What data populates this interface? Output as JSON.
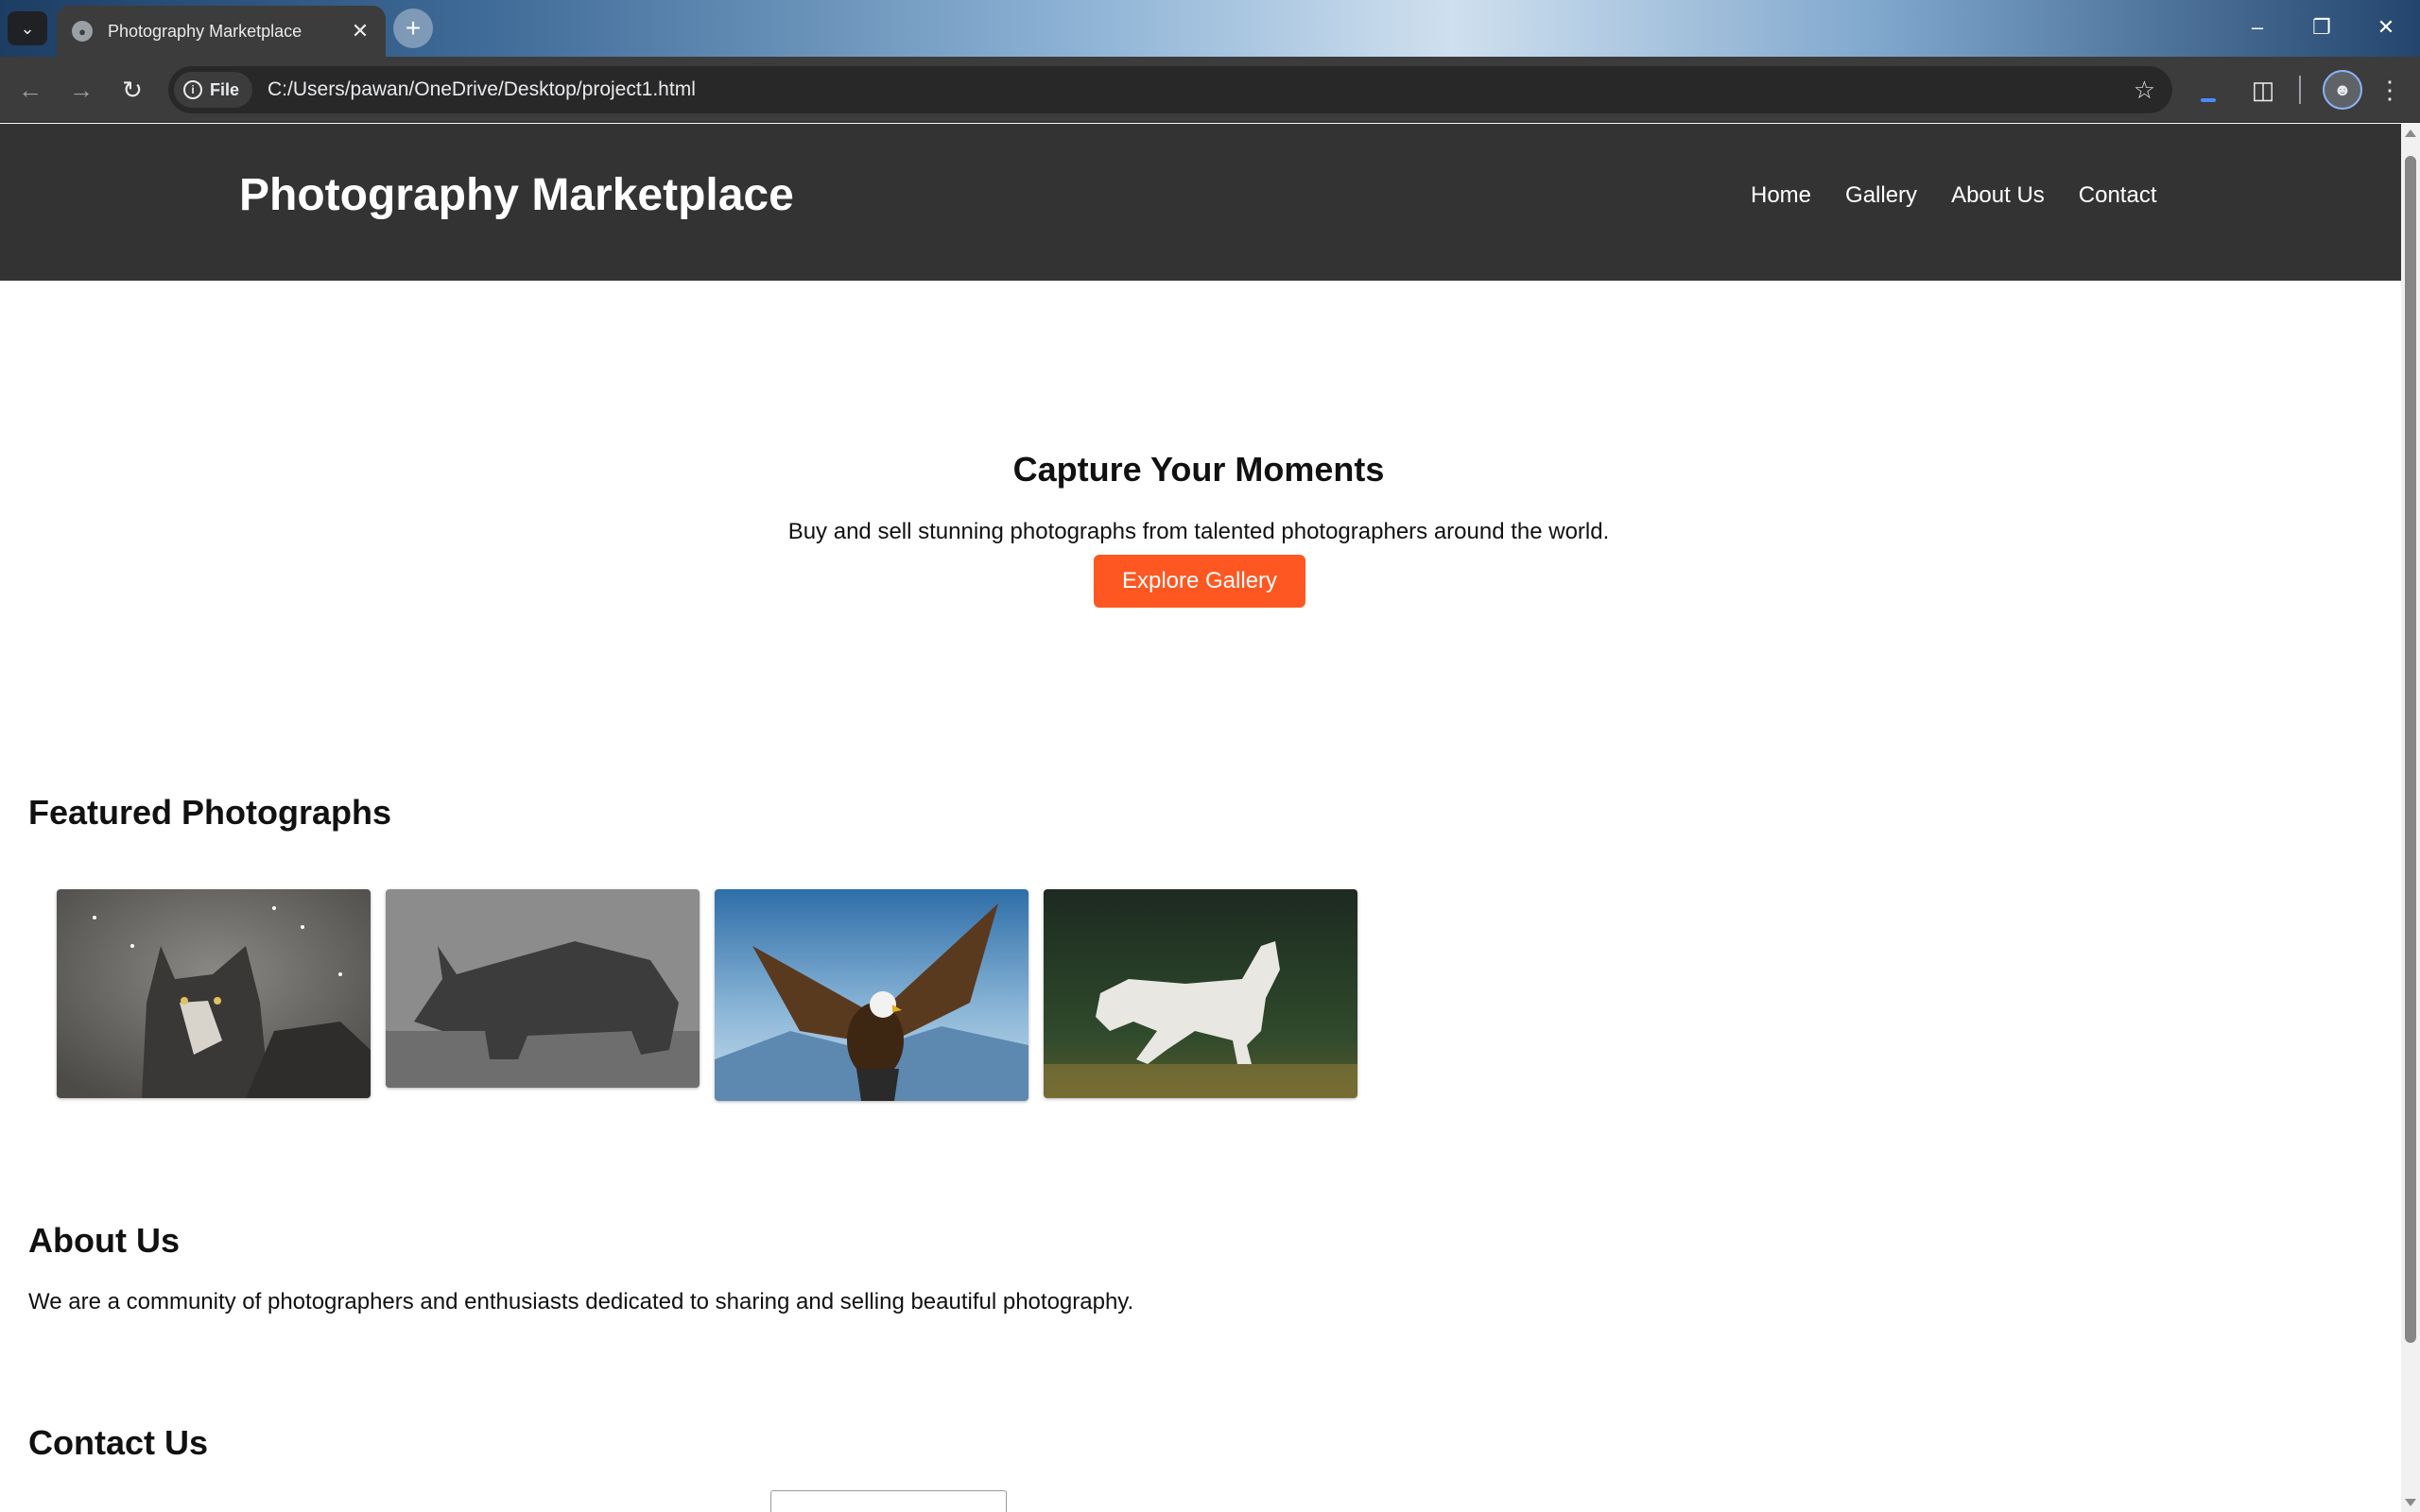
{
  "browser": {
    "tab_title": "Photography Marketplace",
    "url_chip": "File",
    "url": "C:/Users/pawan/OneDrive/Desktop/project1.html"
  },
  "site": {
    "title": "Photography Marketplace",
    "nav": [
      "Home",
      "Gallery",
      "About Us",
      "Contact"
    ]
  },
  "hero": {
    "heading": "Capture Your Moments",
    "subtitle": "Buy and sell stunning photographs from talented photographers around the world.",
    "button": "Explore Gallery"
  },
  "featured": {
    "heading": "Featured Photographs",
    "photos": [
      "wolf-photo",
      "rhino-photo",
      "eagle-photo",
      "horse-photo"
    ]
  },
  "about": {
    "heading": "About Us",
    "text": "We are a community of photographers and enthusiasts dedicated to sharing and selling beautiful photography."
  },
  "contact": {
    "heading": "Contact Us"
  },
  "colors": {
    "header_bg": "#333333",
    "accent": "#ff5722"
  }
}
